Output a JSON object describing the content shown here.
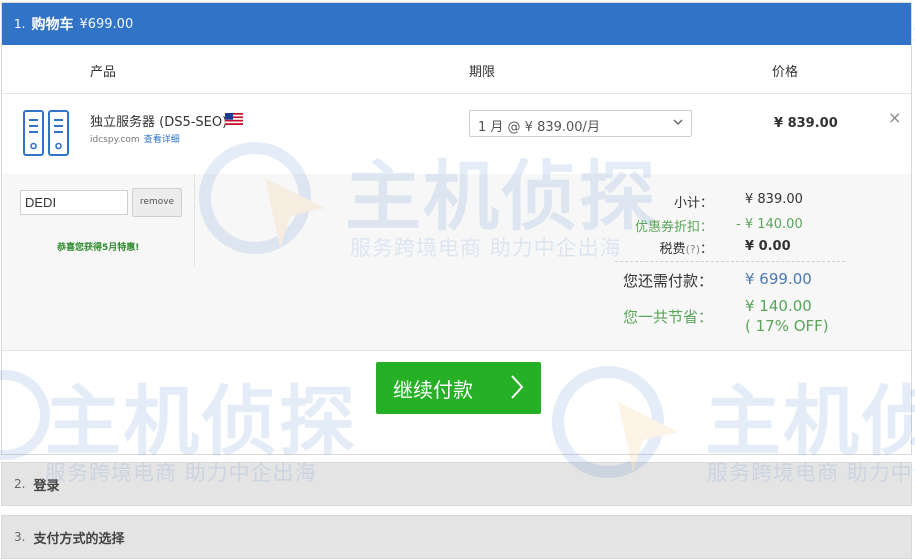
{
  "cart": {
    "step": "1.",
    "title": "购物车",
    "total": "¥699.00"
  },
  "columns": {
    "product": "产品",
    "period": "期限",
    "price": "价格"
  },
  "item": {
    "name": "独立服务器 (DS5-SEO)",
    "domain": "idcspy.com",
    "detail_link": "查看详细",
    "period_selected": "1 月 @ ¥ 839.00/月",
    "price": "¥ 839.00",
    "remove_symbol": "×"
  },
  "promo": {
    "code_value": "DEDI",
    "remove_label": "remove",
    "message": "恭喜您获得5月特惠!"
  },
  "summary": {
    "subtotal_label": "小计：",
    "subtotal_value": "¥ 839.00",
    "discount_label": "优惠券折扣：",
    "discount_value": "- ¥ 140.00",
    "tax_label": "税费",
    "tax_help": "(?)",
    "tax_colon": "：",
    "tax_value": "¥ 0.00",
    "due_label": "您还需付款：",
    "due_value": "¥ 699.00",
    "saved_label": "您一共节省：",
    "saved_value": "¥ 140.00",
    "saved_percent": "( 17% OFF)"
  },
  "continue_button": {
    "label": "继续付款"
  },
  "steps": [
    {
      "num": "2.",
      "title": "登录"
    },
    {
      "num": "3.",
      "title": "支付方式的选择"
    }
  ],
  "watermark": {
    "brand": "主机侦探",
    "slogan": "服务跨境电商 助力中企出海"
  },
  "colors": {
    "header_blue": "#3173c7",
    "button_green": "#25b025",
    "discount_green": "#5aa55a",
    "amount_blue": "#4a7ab0"
  }
}
